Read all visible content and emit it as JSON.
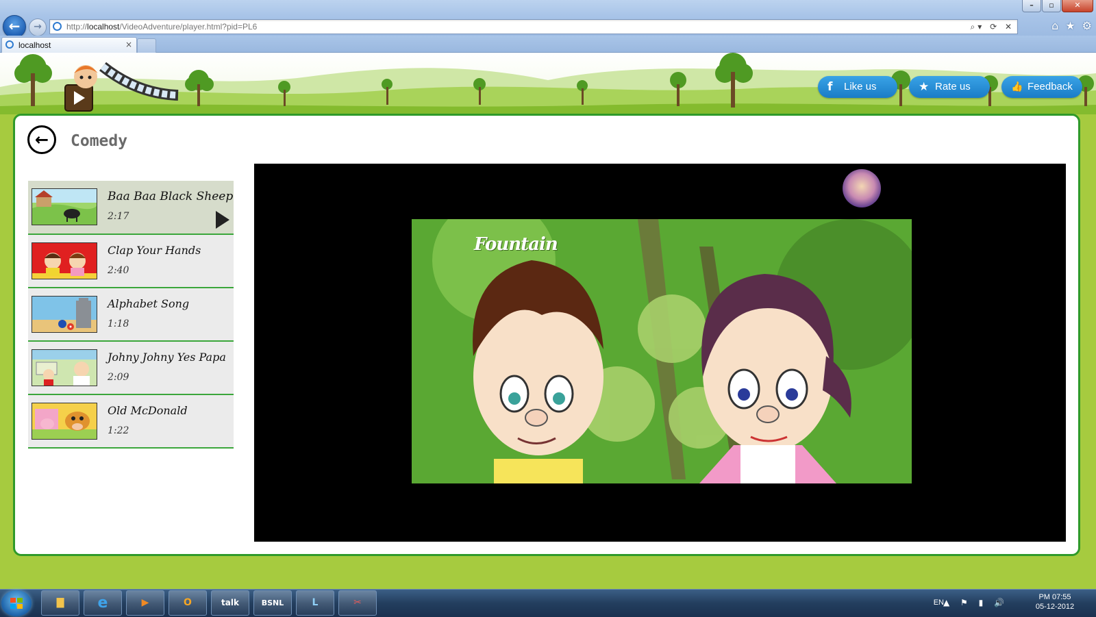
{
  "browser": {
    "url_prefix": "http://",
    "url_host": "localhost",
    "url_path": "/VideoAdventure/player.html?pid=PL6",
    "tab_title": "localhost",
    "tab_close": "×",
    "back_glyph": "←",
    "forward_glyph": "→",
    "addr_tools": "⌕▾ ⟳ ✕",
    "window_controls": [
      "–",
      "▫",
      "✕"
    ],
    "right_tools": [
      "⌂",
      "★",
      "⚙"
    ]
  },
  "header": {
    "social": [
      {
        "label": "Like us",
        "icon": "facebook-icon",
        "glyph": "f"
      },
      {
        "label": "Rate us",
        "icon": "star-icon",
        "glyph": "★"
      },
      {
        "label": "Feedback",
        "icon": "thumbs-up-icon",
        "glyph": "👍"
      }
    ]
  },
  "page": {
    "back_glyph": "←",
    "category_title": "Comedy"
  },
  "playlist": [
    {
      "title": "Baa Baa Black Sheep",
      "duration": "2:17",
      "active": true
    },
    {
      "title": "Clap Your Hands",
      "duration": "2:40",
      "active": false
    },
    {
      "title": "Alphabet Song",
      "duration": "1:18",
      "active": false
    },
    {
      "title": "Johny Johny Yes Papa",
      "duration": "2:09",
      "active": false
    },
    {
      "title": "Old McDonald",
      "duration": "1:22",
      "active": false
    }
  ],
  "player": {
    "video_caption": "Fountain"
  },
  "taskbar": {
    "apps": [
      "Explorer",
      "Internet Explorer",
      "Media Player",
      "Outlook",
      "talk",
      "BSNL",
      "Lync",
      "Snipping"
    ],
    "talk_label": "talk",
    "bsnl_label": "BSNL",
    "language": "EN",
    "tray_icons": "▲ ⚑ ▮ 🔊",
    "time": "PM 07:55",
    "date": "05-12-2012"
  },
  "colors": {
    "accent_green": "#2f9a2a",
    "page_bg": "#a6cb3f",
    "social_blue": "#1a7cc7"
  }
}
